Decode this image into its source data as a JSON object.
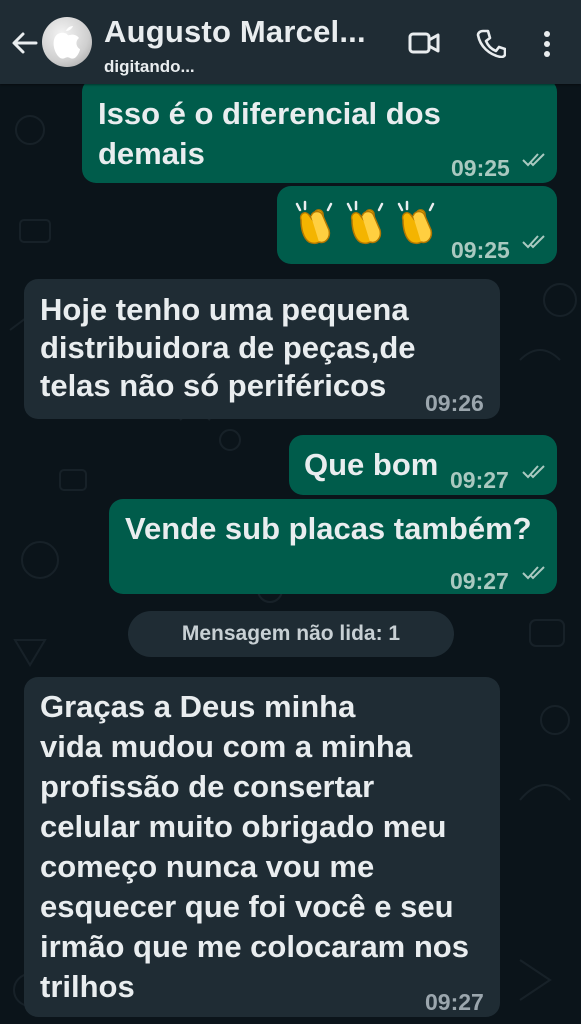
{
  "header": {
    "contact_name": "Augusto Marcel...",
    "status": "digitando...",
    "icons": [
      "back-arrow-icon",
      "video-call-icon",
      "phone-call-icon",
      "more-options-icon"
    ]
  },
  "messages": [
    {
      "direction": "out",
      "text": "Isso é o diferencial dos\ndemais",
      "time": "09:25",
      "read": true
    },
    {
      "direction": "out",
      "text": "👏👏👏",
      "emoji": [
        "clapping-hands",
        "clapping-hands",
        "clapping-hands"
      ],
      "time": "09:25",
      "read": true
    },
    {
      "direction": "in",
      "text": "Hoje tenho uma pequena\ndistribuidora de peças,de\ntelas não só periféricos",
      "time": "09:26"
    },
    {
      "direction": "out",
      "text": "Que bom",
      "time": "09:27",
      "read": true
    },
    {
      "direction": "out",
      "text": "Vende sub placas também?",
      "time": "09:27",
      "read": true
    },
    {
      "direction": "in",
      "text": "Graças a Deus minha\nvida mudou com a minha\nprofissão de consertar\ncelular muito obrigado meu\ncomeço nunca vou me\nesquecer que foi você e seu\nirmão que me colocaram nos\ntrilhos",
      "time": "09:27"
    }
  ],
  "unread_divider": "Mensagem não lida: 1",
  "colors": {
    "background": "#0b141a",
    "header": "#1f2c34",
    "outgoing_bubble": "#005c4b",
    "incoming_bubble": "#1f2c34",
    "read_ticks": "#a9c9c0"
  }
}
